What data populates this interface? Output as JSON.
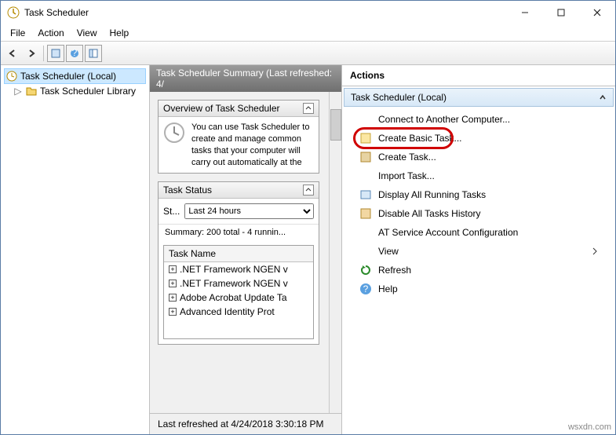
{
  "window": {
    "title": "Task Scheduler"
  },
  "menu": {
    "file": "File",
    "action": "Action",
    "view": "View",
    "help": "Help"
  },
  "tree": {
    "root": "Task Scheduler (Local)",
    "child": "Task Scheduler Library"
  },
  "mid": {
    "header": "Task Scheduler Summary (Last refreshed: 4/",
    "overview_title": "Overview of Task Scheduler",
    "overview_text": "You can use Task Scheduler to create and manage common tasks that your computer will carry out automatically at the",
    "status_title": "Task Status",
    "status_label": "St...",
    "status_select": "Last 24 hours",
    "summary": "Summary: 200 total - 4 runnin...",
    "list_header": "Task Name",
    "tasks": [
      ".NET Framework NGEN v",
      ".NET Framework NGEN v",
      "Adobe Acrobat Update Ta",
      "Advanced Identity Prot"
    ],
    "footer": "Last refreshed at 4/24/2018 3:30:18 PM"
  },
  "actions": {
    "header": "Actions",
    "group": "Task Scheduler (Local)",
    "items": {
      "connect": "Connect to Another Computer...",
      "create_basic": "Create Basic Task...",
      "create_task": "Create Task...",
      "import": "Import Task...",
      "display_running": "Display All Running Tasks",
      "disable_history": "Disable All Tasks History",
      "at_service": "AT Service Account Configuration",
      "view": "View",
      "refresh": "Refresh",
      "help": "Help"
    }
  },
  "watermark": "wsxdn.com"
}
